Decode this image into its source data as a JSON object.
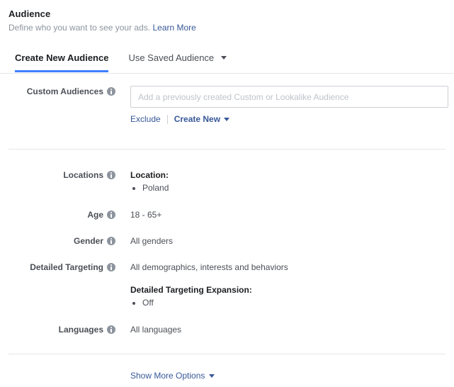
{
  "header": {
    "title": "Audience",
    "description": "Define who you want to see your ads.",
    "learn_more_label": "Learn More"
  },
  "tabs": [
    {
      "label": "Create New Audience",
      "active": true
    },
    {
      "label": "Use Saved Audience",
      "active": false,
      "has_caret": true
    }
  ],
  "custom_audiences": {
    "label": "Custom Audiences",
    "placeholder": "Add a previously created Custom or Lookalike Audience",
    "value": "",
    "exclude_label": "Exclude",
    "create_new_label": "Create New"
  },
  "summary": {
    "locations": {
      "label": "Locations",
      "heading": "Location:",
      "items": [
        "Poland"
      ]
    },
    "age": {
      "label": "Age",
      "value": "18 - 65+"
    },
    "gender": {
      "label": "Gender",
      "value": "All genders"
    },
    "detailed_targeting": {
      "label": "Detailed Targeting",
      "value": "All demographics, interests and behaviors",
      "expansion_heading": "Detailed Targeting Expansion:",
      "expansion_items": [
        "Off"
      ]
    },
    "languages": {
      "label": "Languages",
      "value": "All languages"
    }
  },
  "footer": {
    "show_more_label": "Show More Options"
  },
  "colors": {
    "accent_tab": "#4080ff",
    "link": "#385898",
    "label_text": "#4b4f56",
    "muted_text": "#8d949e",
    "divider": "#e4e6eb",
    "input_border": "#ccd0d5"
  }
}
